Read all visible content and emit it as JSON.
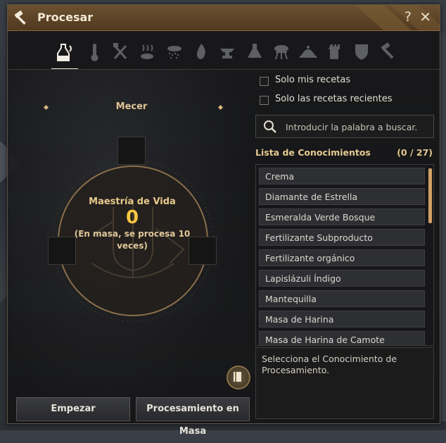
{
  "window": {
    "title": "Procesar",
    "help_label": "?",
    "close_label": "✕"
  },
  "tabs": [
    {
      "icon": "shake-bottle-icon",
      "active": true
    },
    {
      "icon": "thermometer-icon",
      "active": false
    },
    {
      "icon": "axes-icon",
      "active": false
    },
    {
      "icon": "fish-drying-icon",
      "active": false
    },
    {
      "icon": "sieve-icon",
      "active": false
    },
    {
      "icon": "fire-icon",
      "active": false
    },
    {
      "icon": "anvil-icon",
      "active": false
    },
    {
      "icon": "flask-icon",
      "active": false
    },
    {
      "icon": "grill-icon",
      "active": false
    },
    {
      "icon": "serving-cloche-icon",
      "active": false
    },
    {
      "icon": "tower-icon",
      "active": false
    },
    {
      "icon": "shield-crest-icon",
      "active": false
    },
    {
      "icon": "hammer-icon",
      "active": false
    }
  ],
  "left": {
    "mode_label": "Mecer",
    "mastery_label": "Maestría de Vida",
    "mastery_value": "0",
    "mastery_note": "(En masa, se procesa 10 veces)",
    "start_button": "Empezar",
    "mass_button": "Procesamiento en Masa"
  },
  "filters": {
    "only_my_recipes": "Solo mis recetas",
    "recent_recipes": "Solo las recetas recientes"
  },
  "search": {
    "placeholder": "Introducir la palabra a buscar."
  },
  "knowledge": {
    "header": "Lista de Conocimientos",
    "count": "(0 / 27)",
    "items": [
      "Crema",
      "Diamante de Estrella",
      "Esmeralda Verde Bosque",
      "Fertilizante Subproducto",
      "Fertilizante orgánico",
      "Lapislázuli Índigo",
      "Mantequilla",
      "Masa de Harina",
      "Masa de Harina de Camote"
    ],
    "description": "Selecciona el Conocimiento de Procesamiento."
  },
  "colors": {
    "accent_gold": "#e5c991",
    "mastery_yellow": "#f7c640",
    "titlebar": "#5f4528"
  }
}
